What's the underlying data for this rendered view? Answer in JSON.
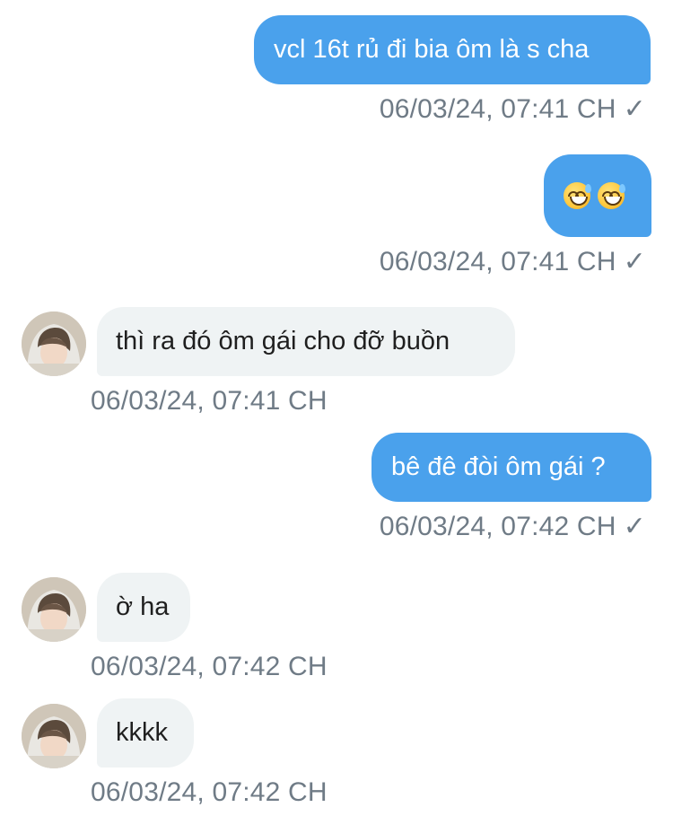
{
  "messages": [
    {
      "id": "m1",
      "from": "me",
      "text": "vcl 16t rủ đi bia ôm là s cha",
      "time": "06/03/24, 07:41 CH",
      "status": "✓"
    },
    {
      "id": "m2",
      "from": "me",
      "text": "😅😅",
      "emoji_icon": "grinning-face-with-sweat",
      "time": "06/03/24, 07:41 CH",
      "status": "✓"
    },
    {
      "id": "m3",
      "from": "them",
      "text": "thì ra đó ôm gái cho đỡ buồn",
      "time": "06/03/24, 07:41 CH"
    },
    {
      "id": "m4",
      "from": "me",
      "text": "bê đê đòi ôm gái ?",
      "time": "06/03/24, 07:42 CH",
      "status": "✓"
    },
    {
      "id": "m5",
      "from": "them",
      "text": "ờ ha",
      "time": "06/03/24, 07:42 CH"
    },
    {
      "id": "m6",
      "from": "them",
      "text": "kkkk",
      "time": "06/03/24, 07:42 CH"
    }
  ],
  "colors": {
    "sent_bubble": "#4aa1ec",
    "recv_bubble": "#eff3f4",
    "timestamp": "#6f7b86"
  }
}
